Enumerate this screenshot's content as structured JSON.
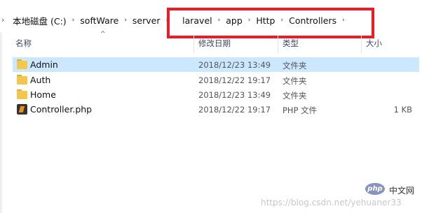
{
  "breadcrumb": {
    "leading_glyph": "›",
    "items": [
      "本地磁盘 (C:)",
      "softWare",
      "server",
      "laravel",
      "app",
      "Http",
      "Controllers"
    ],
    "separator": "›"
  },
  "columns": {
    "name": "名称",
    "date": "修改日期",
    "type": "类型",
    "size": "大小",
    "sort_glyph": "^"
  },
  "rows": [
    {
      "name": "Admin",
      "date": "2018/12/23 13:49",
      "type": "文件夹",
      "size": "",
      "icon": "folder-icon",
      "selected": true
    },
    {
      "name": "Auth",
      "date": "2018/12/22 19:17",
      "type": "文件夹",
      "size": "",
      "icon": "folder-icon"
    },
    {
      "name": "Home",
      "date": "2018/12/23 13:49",
      "type": "文件夹",
      "size": "",
      "icon": "folder-icon"
    },
    {
      "name": "Controller.php",
      "date": "2018/12/22 19:17",
      "type": "PHP 文件",
      "size": "1 KB",
      "icon": "php-file-icon"
    }
  ],
  "colors": {
    "highlight": "#ee1b24",
    "selected_row": "#cce8ff",
    "folder": "#f3c64e"
  },
  "watermark": {
    "badge": "php",
    "label": "中文网",
    "url": "https://blog.csdn.net/yehuaner33"
  }
}
